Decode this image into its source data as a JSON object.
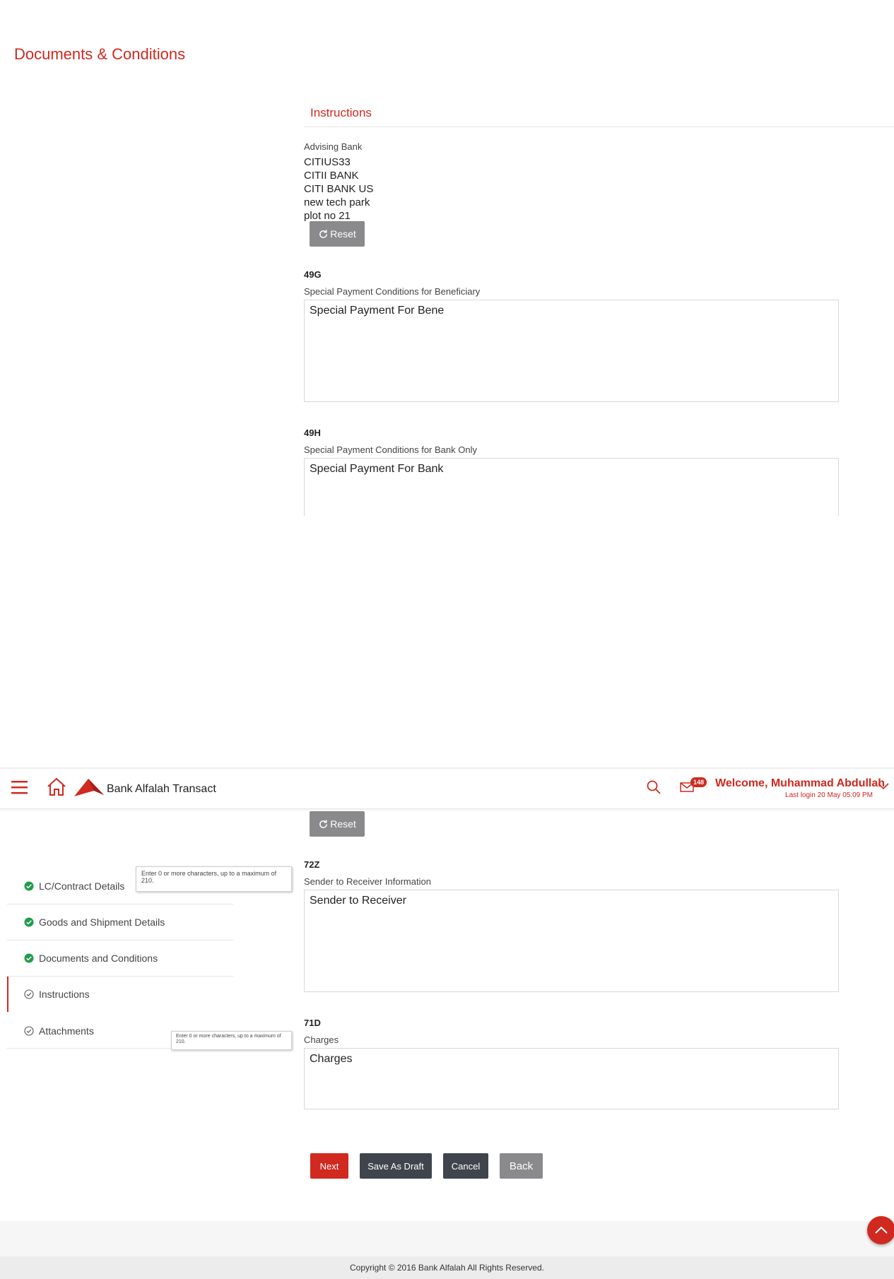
{
  "section_title": "Documents & Conditions",
  "instructions_heading": "Instructions",
  "advising_bank": {
    "label": "Advising Bank",
    "lines": [
      "CITIUS33",
      "CITII BANK",
      "CITI BANK US",
      "new tech park",
      "plot no 21"
    ]
  },
  "reset_label": "Reset",
  "field_49g": {
    "code": "49G",
    "label": "Special Payment Conditions for Beneficiary",
    "value": "Special Payment For Bene"
  },
  "field_49h": {
    "code": "49H",
    "label": "Special Payment Conditions for Bank Only",
    "value": "Special Payment For Bank"
  },
  "header": {
    "app_name": "Bank Alfalah Transact",
    "mail_count": "148",
    "welcome": "Welcome, Muhammad Abdullah",
    "last_login": "Last login 20 May 05:09 PM"
  },
  "sidebar": {
    "items": [
      {
        "label": "LC/Contract Details",
        "state": "done"
      },
      {
        "label": "Goods and Shipment Details",
        "state": "done"
      },
      {
        "label": "Documents and Conditions",
        "state": "done"
      },
      {
        "label": "Instructions",
        "state": "active"
      },
      {
        "label": "Attachments",
        "state": "pending"
      }
    ]
  },
  "tooltips": {
    "tip1": "Enter 0 or more characters, up to a maximum of 210.",
    "tip2": "Enter 0 or more characters, up to a maximum of 210."
  },
  "field_72z": {
    "code": "72Z",
    "label": "Sender to Receiver Information",
    "value": "Sender to Receiver"
  },
  "field_71d": {
    "code": "71D",
    "label": "Charges",
    "value": "Charges"
  },
  "actions": {
    "next": "Next",
    "save_draft": "Save As Draft",
    "cancel": "Cancel",
    "back": "Back"
  },
  "footer": {
    "copyright": "Copyright © 2016 Bank Alfalah All Rights Reserved."
  },
  "colors": {
    "brand_red": "#d0291f",
    "dark_button": "#3f444d",
    "grey_button": "#8a8a8c",
    "success_green": "#1f9d4a"
  }
}
